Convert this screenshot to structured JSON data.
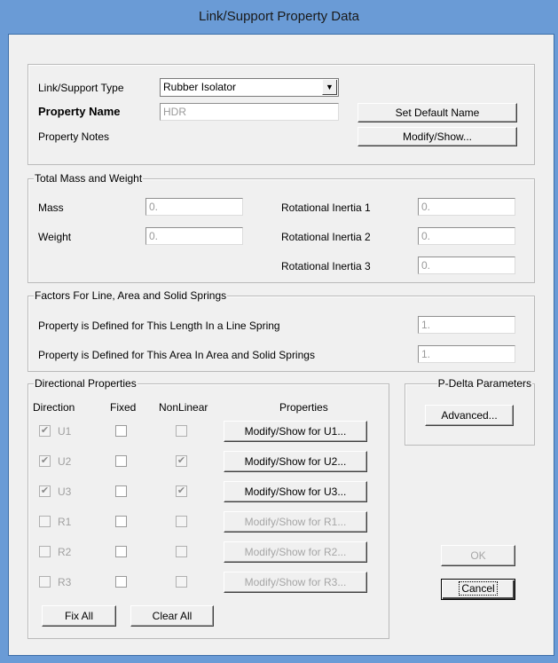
{
  "window": {
    "title": "Link/Support Property Data"
  },
  "header": {
    "type_label": "Link/Support Type",
    "type_value": "Rubber Isolator",
    "name_label": "Property Name",
    "name_value": "HDR",
    "notes_label": "Property Notes",
    "set_default_name_button": "Set Default Name",
    "modify_show_button": "Modify/Show..."
  },
  "mass_weight": {
    "legend": "Total Mass and Weight",
    "mass_label": "Mass",
    "mass_value": "0.",
    "weight_label": "Weight",
    "weight_value": "0.",
    "rot1_label": "Rotational Inertia 1",
    "rot1_value": "0.",
    "rot2_label": "Rotational Inertia 2",
    "rot2_value": "0.",
    "rot3_label": "Rotational Inertia 3",
    "rot3_value": "0."
  },
  "factors": {
    "legend": "Factors For Line, Area and Solid Springs",
    "length_label": "Property is Defined for This Length In a Line Spring",
    "length_value": "1.",
    "area_label": "Property is Defined for This Area In Area and Solid Springs",
    "area_value": "1."
  },
  "directional": {
    "legend": "Directional Properties",
    "col_direction": "Direction",
    "col_fixed": "Fixed",
    "col_nonlinear": "NonLinear",
    "col_properties": "Properties",
    "rows": [
      {
        "dir": "U1",
        "checked": true,
        "fixed": false,
        "nonlinear": false,
        "nonlinear_enabled": false,
        "button": "Modify/Show for U1...",
        "button_enabled": true
      },
      {
        "dir": "U2",
        "checked": true,
        "fixed": false,
        "nonlinear": true,
        "nonlinear_enabled": false,
        "button": "Modify/Show for U2...",
        "button_enabled": true
      },
      {
        "dir": "U3",
        "checked": true,
        "fixed": false,
        "nonlinear": true,
        "nonlinear_enabled": false,
        "button": "Modify/Show for U3...",
        "button_enabled": true
      },
      {
        "dir": "R1",
        "checked": false,
        "fixed": false,
        "nonlinear": false,
        "nonlinear_enabled": false,
        "button": "Modify/Show for R1...",
        "button_enabled": false
      },
      {
        "dir": "R2",
        "checked": false,
        "fixed": false,
        "nonlinear": false,
        "nonlinear_enabled": false,
        "button": "Modify/Show for R2...",
        "button_enabled": false
      },
      {
        "dir": "R3",
        "checked": false,
        "fixed": false,
        "nonlinear": false,
        "nonlinear_enabled": false,
        "button": "Modify/Show for R3...",
        "button_enabled": false
      }
    ],
    "fix_all_button": "Fix All",
    "clear_all_button": "Clear All"
  },
  "pdelta": {
    "legend": "P-Delta Parameters",
    "advanced_button": "Advanced..."
  },
  "footer": {
    "ok_button": "OK",
    "cancel_button": "Cancel"
  },
  "icons": {
    "dropdown": "chevron-down-icon",
    "checkmark": "check-icon"
  },
  "colors": {
    "title_bar": "#6a9bd6",
    "dialog_bg": "#f0f0f0",
    "disabled_text": "#a6a6a6"
  }
}
